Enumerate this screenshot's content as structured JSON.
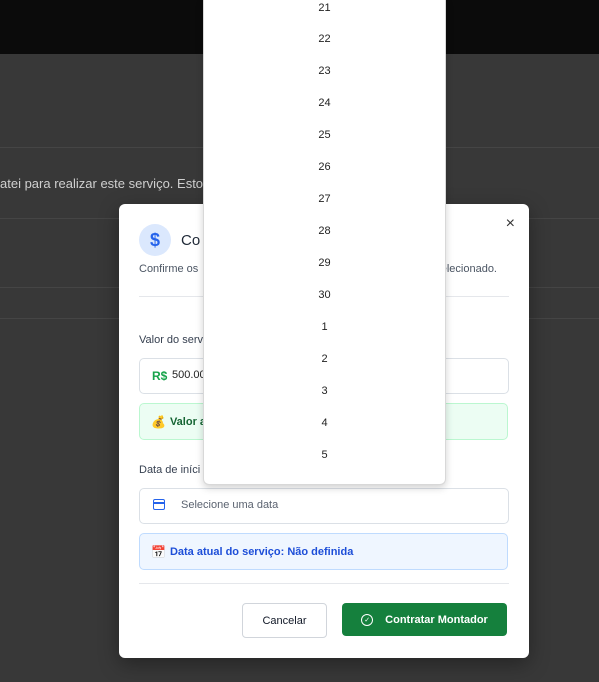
{
  "background": {
    "text": "atei para realizar este serviço. Estou à"
  },
  "modal": {
    "title": "Co",
    "description": "Confirme os",
    "description_tail": "elecionado.",
    "value_label": "Valor do serv",
    "currency": "R$",
    "current_value": "500.00",
    "value_note": "Valor at",
    "date_label": "Data de iníci",
    "date_placeholder": "Selecione uma data",
    "date_note": "Data atual do serviço: Não definida",
    "cancel": "Cancelar",
    "confirm": "Contratar Montador",
    "close": "×"
  },
  "dropdown": {
    "options": [
      "21",
      "22",
      "23",
      "24",
      "25",
      "26",
      "27",
      "28",
      "29",
      "30",
      "1",
      "2",
      "3",
      "4",
      "5"
    ]
  },
  "icons": {
    "dollar": "dollar-icon",
    "money_bag": "money-bag-icon",
    "calendar": "calendar-icon",
    "calendar_emoji": "calendar-emoji-icon",
    "check": "check-icon"
  },
  "colors": {
    "primary_blue": "#2563eb",
    "success_green": "#15803d"
  }
}
